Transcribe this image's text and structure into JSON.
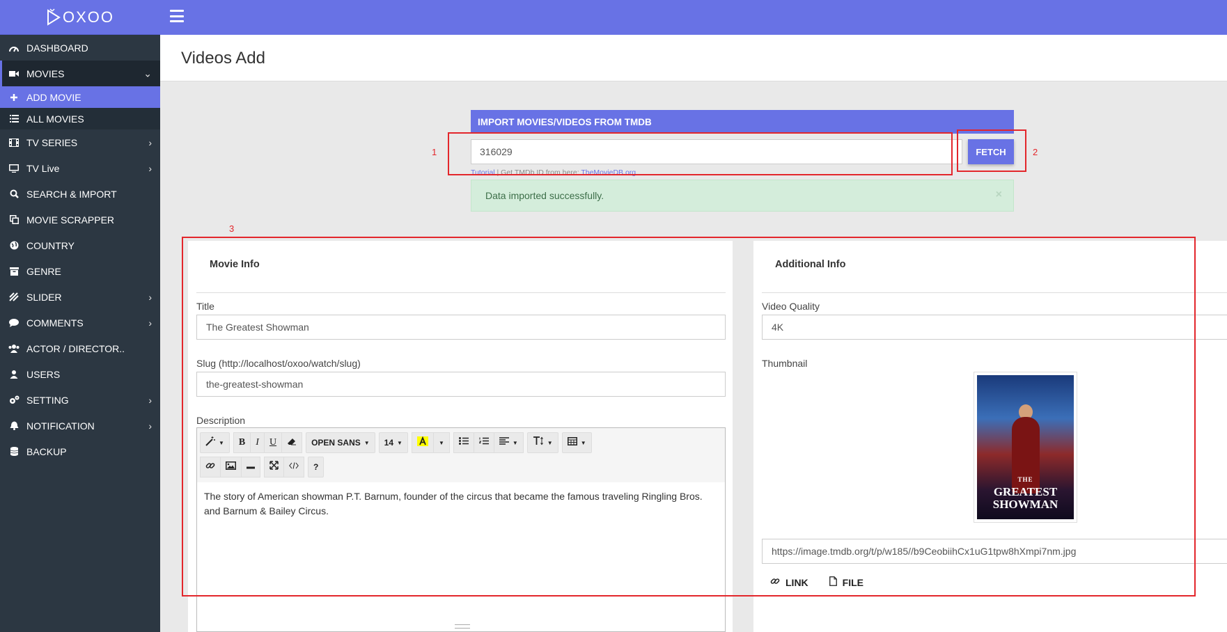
{
  "brand": {
    "logo_text": "OXOO"
  },
  "sidebar": {
    "items": [
      {
        "label": "DASHBOARD",
        "icon": "dashboard-icon",
        "chevron": ""
      },
      {
        "label": "MOVIES",
        "icon": "video-camera-icon",
        "chevron": "⌄"
      },
      {
        "label": "ADD MOVIE",
        "icon": "plus-icon"
      },
      {
        "label": "ALL MOVIES",
        "icon": "list-icon"
      },
      {
        "label": "TV SERIES",
        "icon": "film-icon",
        "chevron": "›"
      },
      {
        "label": "TV Live",
        "icon": "monitor-icon",
        "chevron": "›"
      },
      {
        "label": "SEARCH & IMPORT",
        "icon": "search-icon",
        "chevron": ""
      },
      {
        "label": "MOVIE SCRAPPER",
        "icon": "copy-icon",
        "chevron": ""
      },
      {
        "label": "COUNTRY",
        "icon": "globe-icon",
        "chevron": ""
      },
      {
        "label": "GENRE",
        "icon": "archive-icon",
        "chevron": ""
      },
      {
        "label": "SLIDER",
        "icon": "sliders-icon",
        "chevron": "›"
      },
      {
        "label": "COMMENTS",
        "icon": "comment-icon",
        "chevron": "›"
      },
      {
        "label": "ACTOR / DIRECTOR..",
        "icon": "users-icon",
        "chevron": ""
      },
      {
        "label": "USERS",
        "icon": "user-icon",
        "chevron": ""
      },
      {
        "label": "SETTING",
        "icon": "gears-icon",
        "chevron": "›"
      },
      {
        "label": "NOTIFICATION",
        "icon": "bell-icon",
        "chevron": "›"
      },
      {
        "label": "BACKUP",
        "icon": "database-icon",
        "chevron": ""
      }
    ]
  },
  "page": {
    "title": "Videos Add"
  },
  "tmdb": {
    "header": "IMPORT MOVIES/VIDEOS FROM TMDB",
    "input_value": "316029",
    "fetch_label": "FETCH",
    "help_tutorial": "Tutorial",
    "help_separator": " | Get TMDb ID from here: ",
    "help_link": "TheMovieDB.org"
  },
  "alert": {
    "message": "Data imported successfully.",
    "close": "×"
  },
  "movie_info": {
    "title": "Movie Info",
    "title_label": "Title",
    "title_value": "The Greatest Showman",
    "slug_label": "Slug (http://localhost/oxoo/watch/slug)",
    "slug_value": "the-greatest-showman",
    "description_label": "Description",
    "description_text": "The story of American showman P.T. Barnum, founder of the circus that became the famous traveling Ringling Bros. and Barnum & Bailey Circus."
  },
  "editor_toolbar": {
    "font_name": "OPEN SANS",
    "font_size": "14",
    "bold": "B",
    "italic": "I",
    "underline": "U",
    "help": "?"
  },
  "additional_info": {
    "title": "Additional Info",
    "quality_label": "Video Quality",
    "quality_value": "4K",
    "thumbnail_label": "Thumbnail",
    "thumbnail_url": "https://image.tmdb.org/t/p/w185//b9CeobiihCx1uG1tpw8hXmpi7nm.jpg",
    "link_label": "LINK",
    "file_label": "FILE"
  },
  "poster": {
    "the": "THE",
    "line1": "GREATEST",
    "line2": "SHOWMAN"
  },
  "annotations": {
    "n1": "1",
    "n2": "2",
    "n3": "3"
  },
  "colors": {
    "accent": "#6872e5",
    "sidebar": "#2c3742",
    "annotation": "#e3262b"
  }
}
